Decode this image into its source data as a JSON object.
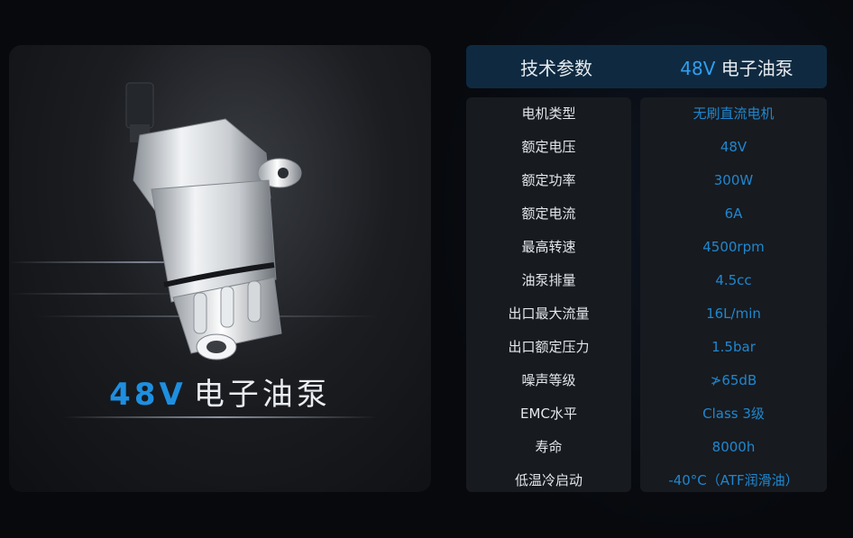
{
  "product": {
    "title_accent": "48V",
    "title_main": "电子油泵"
  },
  "spec_table": {
    "header_left": "技术参数",
    "header_right_accent": "48V",
    "header_right_main": " 电子油泵",
    "rows": [
      {
        "label": "电机类型",
        "value": "无刷直流电机"
      },
      {
        "label": "额定电压",
        "value": "48V"
      },
      {
        "label": "额定功率",
        "value": "300W"
      },
      {
        "label": "额定电流",
        "value": "6A"
      },
      {
        "label": "最高转速",
        "value": "4500rpm"
      },
      {
        "label": "油泵排量",
        "value": "4.5cc"
      },
      {
        "label": "出口最大流量",
        "value": "16L/min"
      },
      {
        "label": "出口额定压力",
        "value": "1.5bar"
      },
      {
        "label": "噪声等级",
        "value": "≯65dB"
      },
      {
        "label": "EMC水平",
        "value": "Class 3级"
      },
      {
        "label": "寿命",
        "value": "8000h"
      },
      {
        "label": "低温冷启动",
        "value": "-40°C（ATF润滑油）"
      }
    ]
  },
  "colors": {
    "accent": "#1e8fe0",
    "value_text": "#1f87cf",
    "header_bg": "#0f2a40"
  }
}
